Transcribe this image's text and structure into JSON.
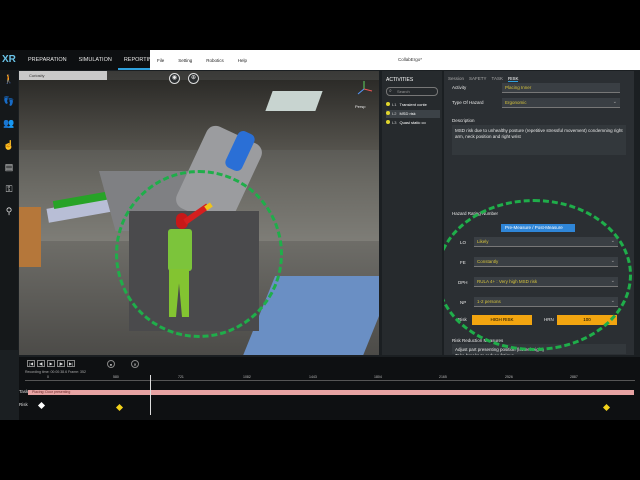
{
  "app": {
    "logo": "XR",
    "window_title": "CollabErgo*",
    "main_tabs": [
      "PREPARATION",
      "SIMULATION",
      "REPORTING"
    ],
    "menu": [
      "File",
      "Setting",
      "Robotics",
      "Help"
    ]
  },
  "viewport": {
    "header_label": "Curiosity",
    "gizmo_label": "Persp"
  },
  "activities": {
    "title": "ACTIVITIES",
    "search_placeholder": "Search",
    "items": [
      {
        "id": "L1",
        "name": "Transient conte"
      },
      {
        "id": "L2",
        "name": "MSD risk"
      },
      {
        "id": "L3",
        "name": "Quasi static co"
      }
    ]
  },
  "details": {
    "tabs": [
      "Session",
      "SAFETY",
      "TASK",
      "RISK"
    ],
    "activity_label": "Activity",
    "activity_value": "Placing Inner",
    "hazard_type_label": "Type Of Hazard",
    "hazard_type_value": "Ergonomic",
    "description_label": "Description",
    "description_text": "MSD risk due to unhealthy posture (repetitive stressful movement) condemning right arm, neck position and right wrist",
    "rating_title": "Hazard Rating Number",
    "rating_mode": "Pre-Measure / Post-Measure",
    "lo_label": "LO",
    "lo_value": "Likely",
    "fe_label": "FE",
    "fe_value": "Constantly",
    "dph_label": "DPH",
    "dph_value": "RULA 4+ : Very high MSD risk",
    "np_label": "NP",
    "np_value": "1-2 persons",
    "risk_label": "Risk",
    "risk_value": "HIGH RISK",
    "hrn_label": "HRN",
    "hrn_value": "100",
    "reduction_title": "Risk Reduction Measures",
    "reduction_text": "Adjust part presenting position (lower height)\nTake breaks to reduce fatigue"
  },
  "timeline": {
    "info": "Recording time: 00:00:38.6     Frame: 352",
    "ticks": [
      "0",
      "580",
      "721",
      "1082",
      "1443",
      "1804",
      "2165",
      "2526",
      "2887"
    ],
    "row_task": "Task",
    "row_risk": "Risk",
    "task_bar_label": "Placing: Door presenting"
  },
  "colors": {
    "accent": "#2fa1dd",
    "risk_badge": "#f2a510",
    "select_text": "#d6c33a",
    "annotation_circle": "#1fae4a"
  }
}
